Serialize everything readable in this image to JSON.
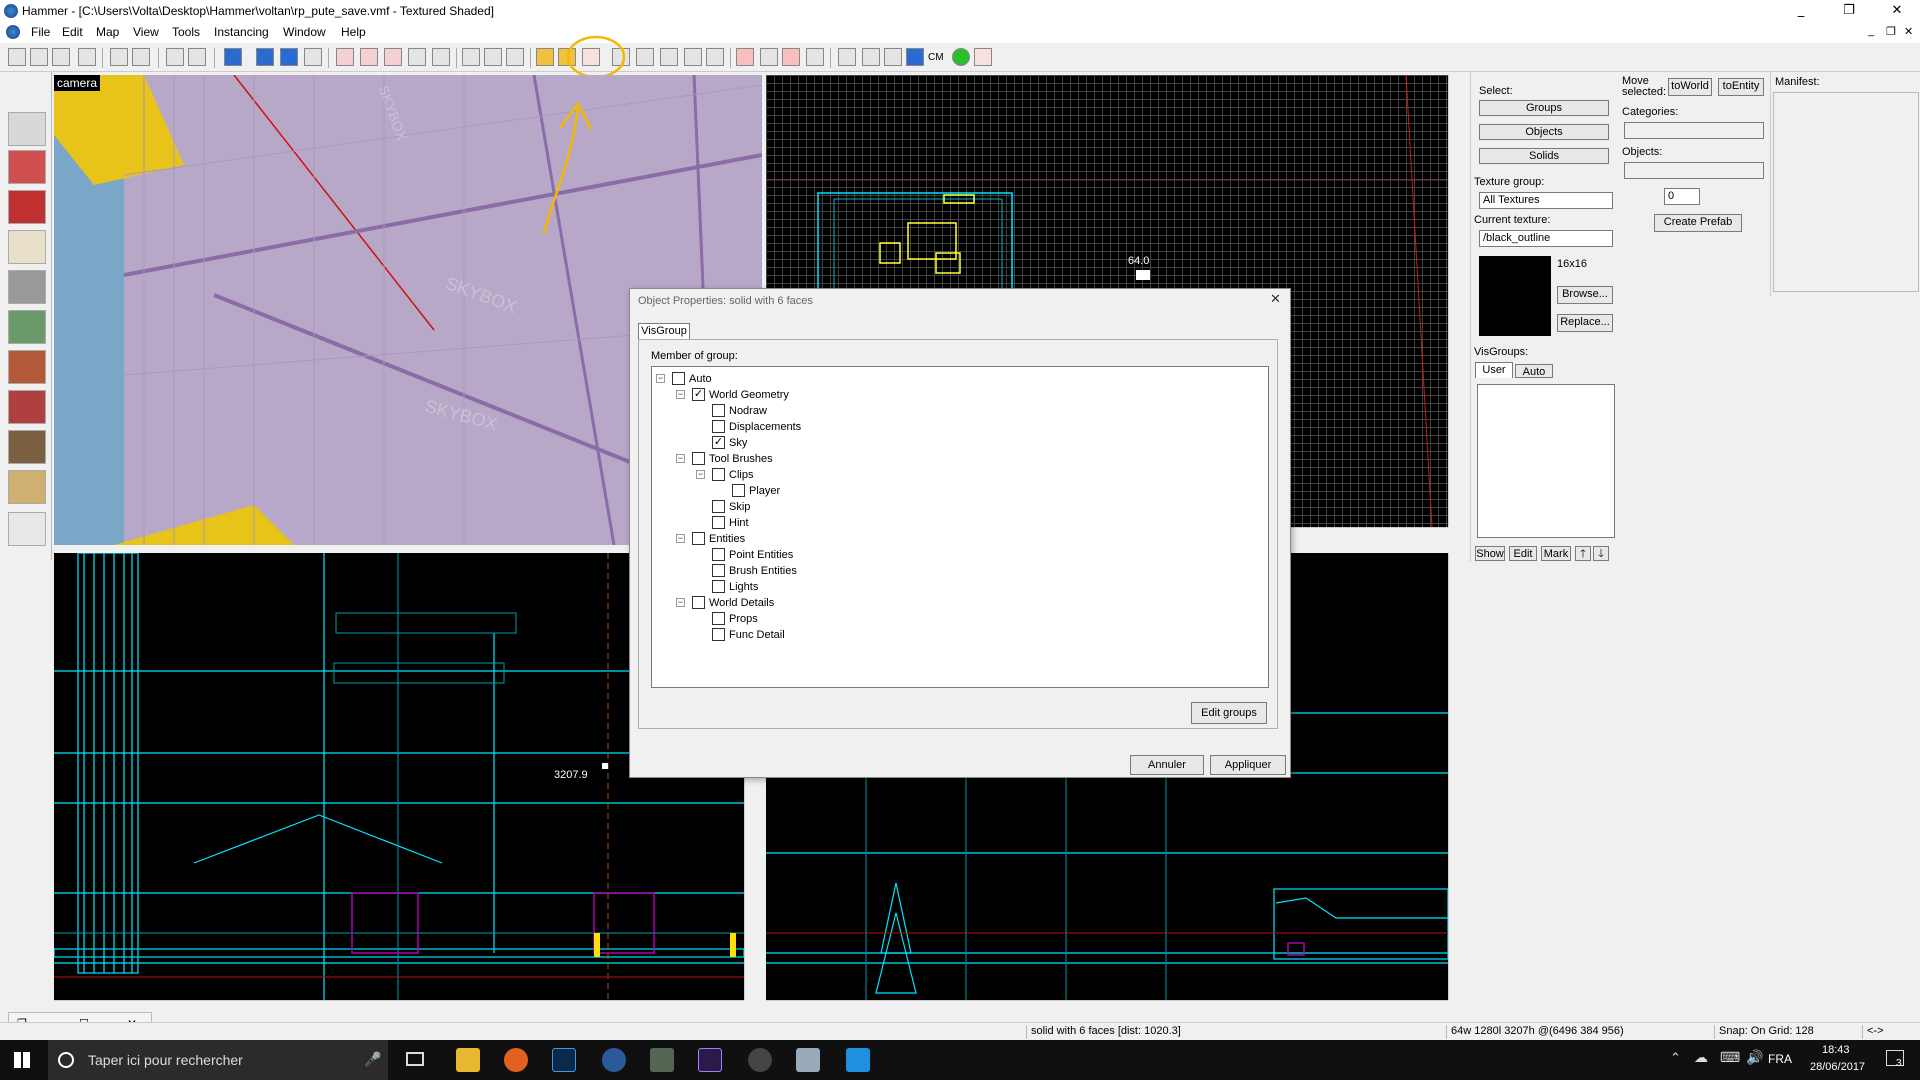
{
  "window": {
    "title": "Hammer - [C:\\Users\\Volta\\Desktop\\Hammer\\voltan\\rp_pute_save.vmf - Textured Shaded]",
    "min": "_",
    "max": "❐",
    "close": "✕"
  },
  "menu": [
    "File",
    "Edit",
    "Map",
    "View",
    "Tools",
    "Instancing",
    "Window",
    "Help"
  ],
  "toolbar": {
    "cm_label": "CM"
  },
  "viewports": {
    "camera_label": "camera",
    "sky_text_1": "SKYBOX",
    "sky_text_2": "SKYBOX",
    "sky_text_3": "SKYBOX",
    "top_right_coord": "64.0",
    "bottom_left_coord": "3207.9"
  },
  "select_panel": {
    "label": "Select:",
    "groups": "Groups",
    "objects": "Objects",
    "solids": "Solids",
    "texture_group_label": "Texture group:",
    "texture_group_value": "All Textures",
    "current_texture_label": "Current texture:",
    "current_texture_value": "/black_outline",
    "texture_size": "16x16",
    "browse": "Browse...",
    "replace": "Replace...",
    "visgroups_label": "VisGroups:",
    "tab_user": "User",
    "tab_auto": "Auto",
    "show": "Show",
    "edit": "Edit",
    "mark": "Mark",
    "up": "🡑",
    "down": "🡓"
  },
  "move_panel": {
    "label": "Move selected:",
    "to_world": "toWorld",
    "to_entity": "toEntity",
    "categories_label": "Categories:",
    "objects_label": "Objects:",
    "count_value": "0",
    "create_prefab": "Create Prefab"
  },
  "manifest": {
    "label": "Manifest:"
  },
  "dialog": {
    "title": "Object Properties: solid with 6 faces",
    "tab": "VisGroup",
    "member_label": "Member of group:",
    "tree": [
      {
        "label": "Auto",
        "checked": false,
        "level": 0,
        "expander": "−"
      },
      {
        "label": "World Geometry",
        "checked": true,
        "level": 1,
        "expander": "−"
      },
      {
        "label": "Nodraw",
        "checked": false,
        "level": 2,
        "expander": ""
      },
      {
        "label": "Displacements",
        "checked": false,
        "level": 2,
        "expander": ""
      },
      {
        "label": "Sky",
        "checked": true,
        "level": 2,
        "expander": ""
      },
      {
        "label": "Tool Brushes",
        "checked": false,
        "level": 1,
        "expander": "−"
      },
      {
        "label": "Clips",
        "checked": false,
        "level": 2,
        "expander": "−"
      },
      {
        "label": "Player",
        "checked": false,
        "level": 3,
        "expander": ""
      },
      {
        "label": "Skip",
        "checked": false,
        "level": 2,
        "expander": ""
      },
      {
        "label": "Hint",
        "checked": false,
        "level": 2,
        "expander": ""
      },
      {
        "label": "Entities",
        "checked": false,
        "level": 1,
        "expander": "−"
      },
      {
        "label": "Point Entities",
        "checked": false,
        "level": 2,
        "expander": ""
      },
      {
        "label": "Brush Entities",
        "checked": false,
        "level": 2,
        "expander": ""
      },
      {
        "label": "Lights",
        "checked": false,
        "level": 2,
        "expander": ""
      },
      {
        "label": "World Details",
        "checked": false,
        "level": 1,
        "expander": "−"
      },
      {
        "label": "Props",
        "checked": false,
        "level": 2,
        "expander": ""
      },
      {
        "label": "Func Detail",
        "checked": false,
        "level": 2,
        "expander": ""
      }
    ],
    "edit_groups": "Edit groups",
    "cancel": "Annuler",
    "apply": "Appliquer"
  },
  "statusbar": {
    "selection": "solid with 6 faces  [dist: 1020.3]",
    "dims": "64w 1280l 3207h @(6496 384 956)",
    "snap": "Snap: On Grid: 128",
    "nav": "<->"
  },
  "taskbar": {
    "search_placeholder": "Taper ici pour rechercher",
    "lang": "FRA",
    "time": "18:43",
    "date": "28/06/2017",
    "notif_count": "3"
  },
  "colors": {
    "accent_cyan": "#00e5ff",
    "annotation_yellow": "#f5b800",
    "sky_purple": "#b8a8c8",
    "grid_black": "#000000"
  }
}
